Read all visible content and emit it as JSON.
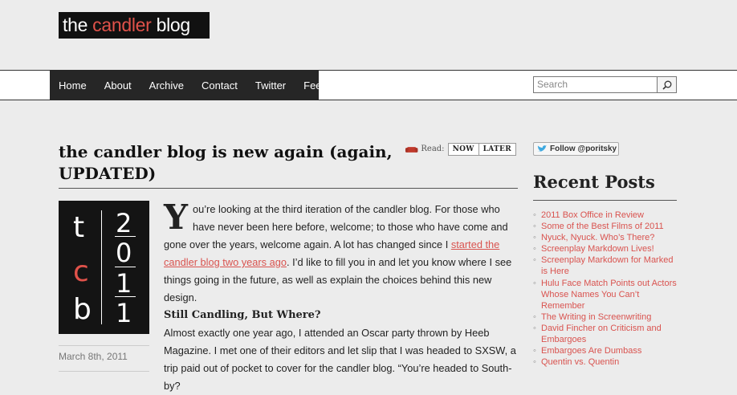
{
  "site": {
    "logo_prefix": "the ",
    "logo_accent": "candler",
    "logo_suffix": " blog"
  },
  "nav": [
    "Home",
    "About",
    "Archive",
    "Contact",
    "Twitter",
    "Feed"
  ],
  "search": {
    "placeholder": "Search"
  },
  "post": {
    "title": "the candler blog is new again (again, UPDATED)",
    "readlater": {
      "label": "Read:",
      "now": "NOW",
      "later": "LATER"
    },
    "date": "March 8th, 2011",
    "badge": {
      "t": "t",
      "c": "c",
      "b": "b",
      "n1": "2",
      "n2": "0",
      "n3": "1",
      "n4": "1"
    },
    "dropcap": "Y",
    "p1_a": "ou’re looking at the third iteration of the candler blog. For those who have never been here before, welcome; to those who have come and gone over the years, welcome again. A lot has changed since I ",
    "p1_link": "started the candler blog two years ago",
    "p1_b": ". I’d like to fill you in and let you know where I see things going in the future, as well as explain the choices behind this new design.",
    "subheading": "Still Candling, But Where?",
    "p2": "Almost exactly one year ago, I attended an Oscar party thrown by Heeb Magazine. I met one of their editors and let slip that I was headed to SXSW, a trip paid out of pocket to cover for the candler blog. “You’re headed to South-by?"
  },
  "sidebar": {
    "follow": "Follow @poritsky",
    "recent_title": "Recent Posts",
    "recent": [
      "2011 Box Office in Review",
      "Some of the Best Films of 2011",
      "Nyuck, Nyuck. Who’s There?",
      "Screenplay Markdown Lives!",
      "Screenplay Markdown for Marked is Here",
      "Hulu Face Match Points out Actors Whose Names You Can’t Remember",
      "The Writing in Screenwriting",
      "David Fincher on Criticism and Embargoes",
      "Embargoes Are Dumbass",
      "Quentin vs. Quentin"
    ]
  },
  "colors": {
    "accent": "#d9534f",
    "nav_bg": "#262626",
    "page_bg": "#ececec"
  }
}
